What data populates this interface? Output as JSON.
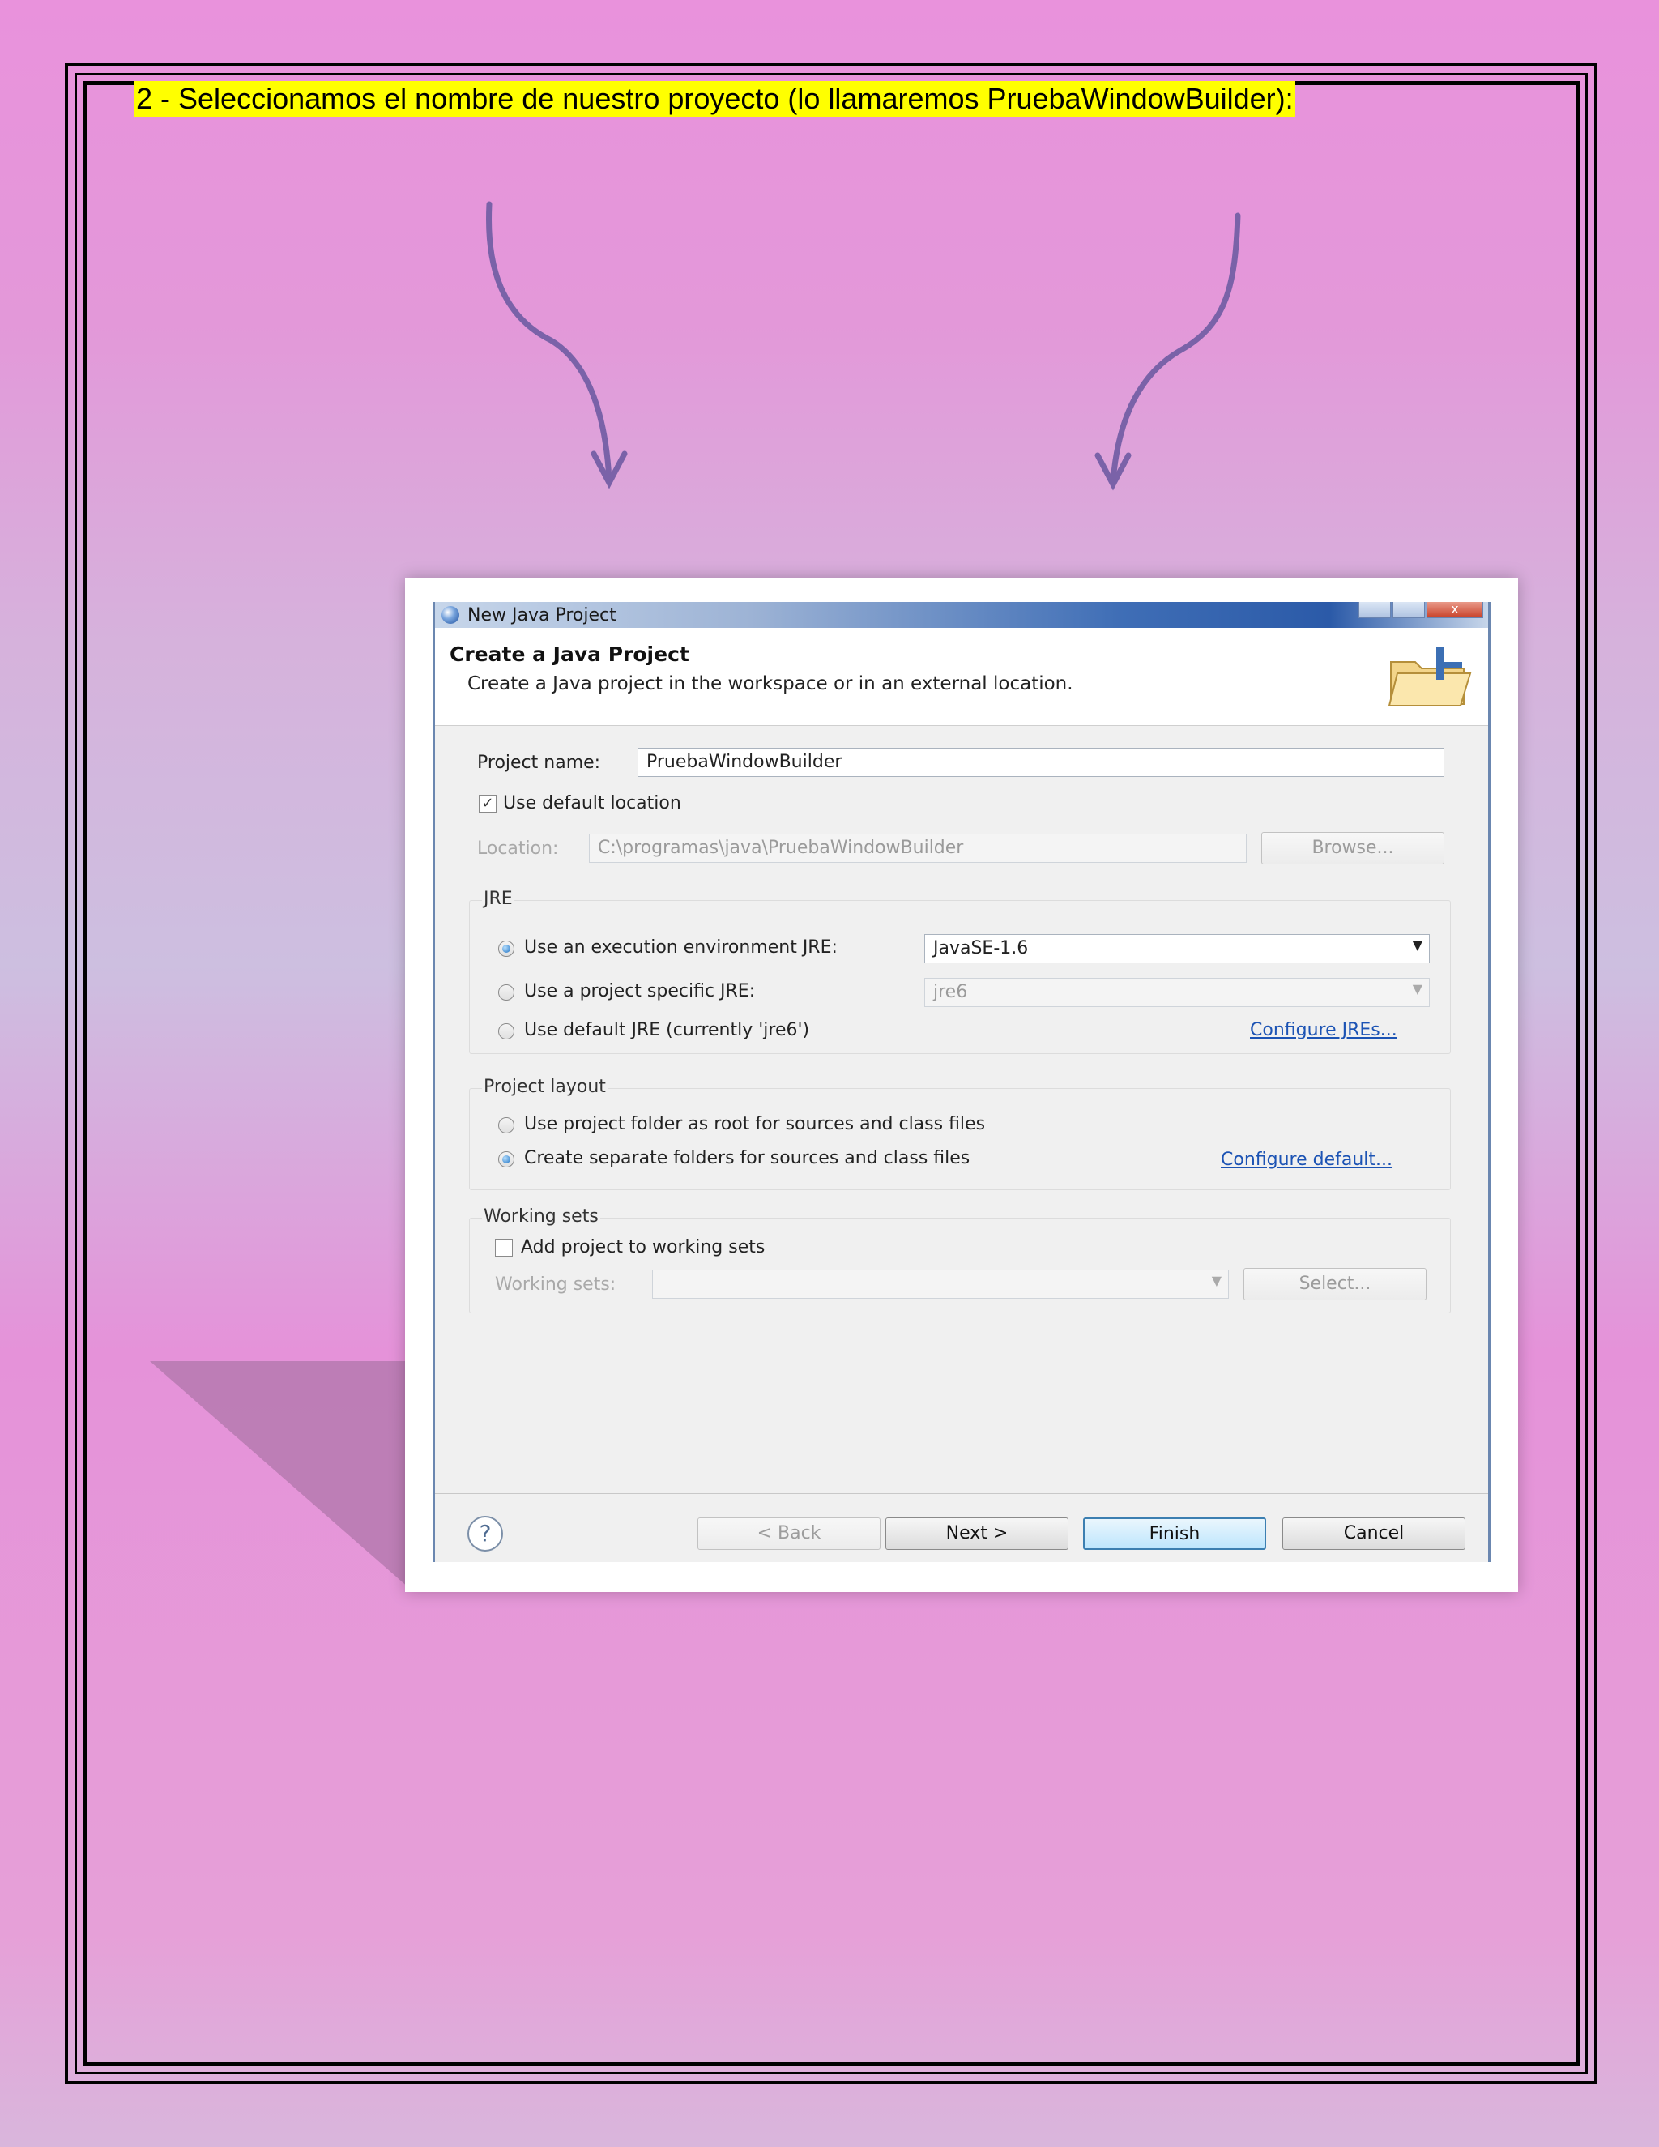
{
  "heading": "2 - Seleccionamos el nombre de nuestro proyecto (lo llamaremos PruebaWindowBuilder):",
  "dialog": {
    "window_title": "New Java Project",
    "close_glyph": "x",
    "header_title": "Create a Java Project",
    "header_desc": "Create a Java project in the workspace or in an external location.",
    "project_name_label": "Project name:",
    "project_name_value": "PruebaWindowBuilder",
    "use_default_location_label": "Use default location",
    "use_default_location_checked": true,
    "location_label": "Location:",
    "location_value": "C:\\programas\\java\\PruebaWindowBuilder",
    "browse_label": "Browse...",
    "jre": {
      "group_title": "JRE",
      "option_exec_env": "Use an execution environment JRE:",
      "exec_env_value": "JavaSE-1.6",
      "option_project_specific": "Use a project specific JRE:",
      "project_specific_value": "jre6",
      "option_default": "Use default JRE (currently 'jre6')",
      "configure_link": "Configure JREs...",
      "selected": "exec_env"
    },
    "project_layout": {
      "group_title": "Project layout",
      "option_root": "Use project folder as root for sources and class files",
      "option_separate": "Create separate folders for sources and class files",
      "configure_link": "Configure default...",
      "selected": "separate"
    },
    "working_sets": {
      "group_title": "Working sets",
      "add_label": "Add project to working sets",
      "add_checked": false,
      "sets_label": "Working sets:",
      "sets_value": "",
      "select_label": "Select..."
    },
    "buttons": {
      "help": "?",
      "back": "< Back",
      "next": "Next >",
      "finish": "Finish",
      "cancel": "Cancel"
    },
    "check_glyph": "✓"
  },
  "colors": {
    "page_pink": "#e992dc",
    "page_lavender": "#cdbfe0",
    "arrow": "#7a62a8",
    "heading_highlight": "#ffff00",
    "link": "#1c53b4"
  }
}
